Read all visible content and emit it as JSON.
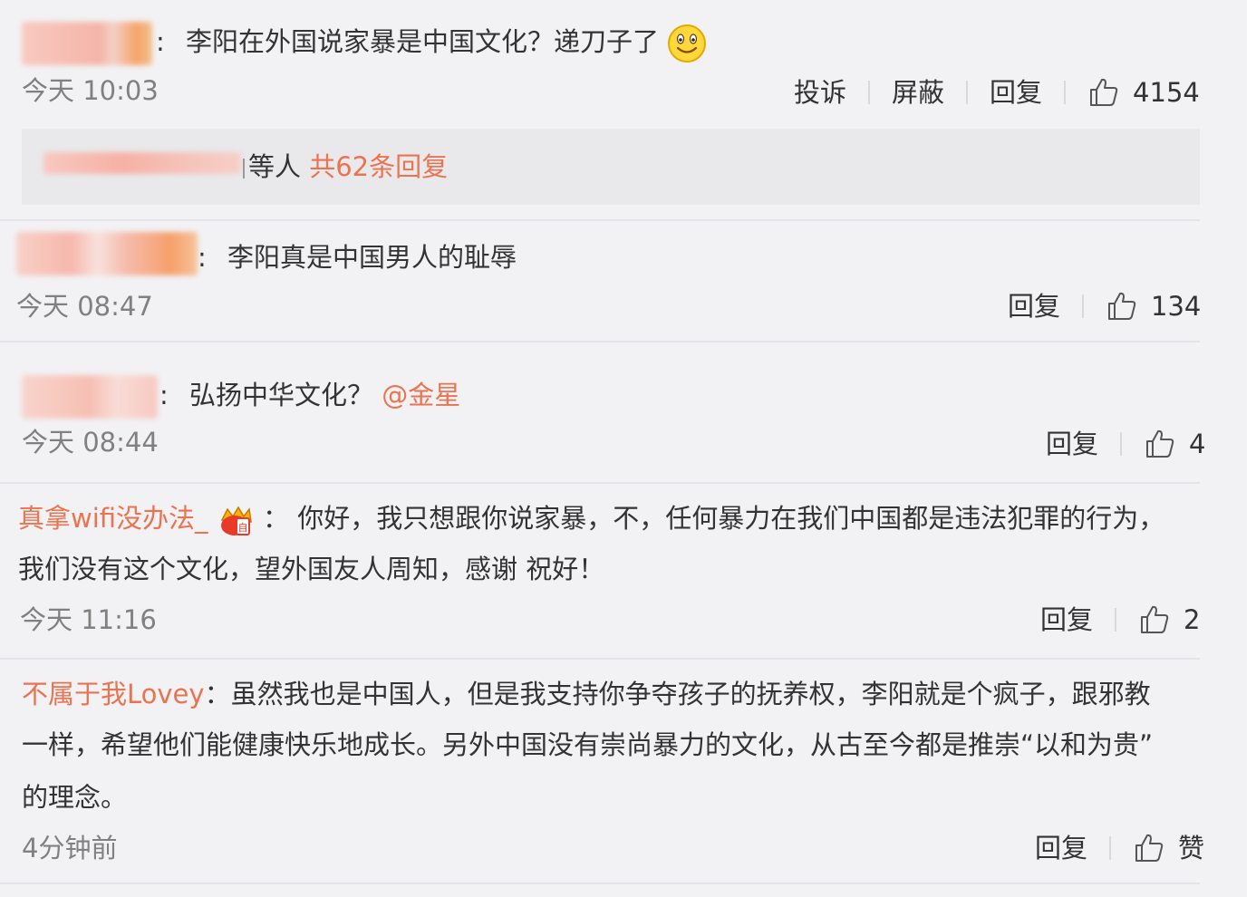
{
  "comments": [
    {
      "separator": ":",
      "text": "李阳在外国说家暴是中国文化？递刀子了",
      "emoji": "smile-emoji",
      "time": "今天 10:03",
      "actions": {
        "report": "投诉",
        "block": "屏蔽",
        "reply": "回复"
      },
      "likes": "4154",
      "replies_summary": {
        "prefix": "等人",
        "link": "共62条回复"
      }
    },
    {
      "separator": ":",
      "text": "李阳真是中国男人的耻辱",
      "time": "今天 08:47",
      "actions": {
        "reply": "回复"
      },
      "likes": "134"
    },
    {
      "separator": ":",
      "text": "弘扬中华文化？",
      "mention": "@金星",
      "time": "今天 08:44",
      "actions": {
        "reply": "回复"
      },
      "likes": "4"
    },
    {
      "username": "真拿wifi没办法_",
      "separator": "：",
      "line1": "你好，我只想跟你说家暴，不，任何暴力在我们中国都是违法犯罪的行为，",
      "line2": "我们没有这个文化，望外国友人周知，感谢 祝好！",
      "time": "今天 11:16",
      "actions": {
        "reply": "回复"
      },
      "likes": "2"
    },
    {
      "username": "不属于我Lovey",
      "separator": "：",
      "line1": "虽然我也是中国人，但是我支持你争夺孩子的抚养权，李阳就是个疯子，跟邪教",
      "line2": "一样，希望他们能健康快乐地成长。另外中国没有崇尚暴力的文化，从古至今都是推崇“以和为贵”",
      "line3": "的理念。",
      "time": "4分钟前",
      "actions": {
        "reply": "回复"
      },
      "likes": "赞"
    }
  ],
  "colors": {
    "background": "#f2f2f5",
    "username": "#eb7350",
    "text": "#333333",
    "muted": "#808080"
  }
}
